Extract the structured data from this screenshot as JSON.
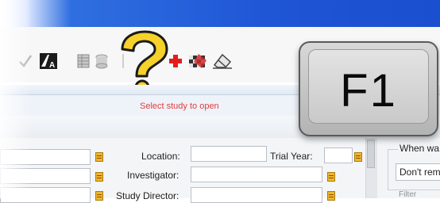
{
  "toolbar": {
    "icons": [
      "check-icon",
      "font-icon",
      "grid-icon",
      "drum-icon",
      "separator-icon",
      "help-icon",
      "plus-icon",
      "flag-icon",
      "eraser-icon"
    ]
  },
  "status": {
    "message": "Select study to open",
    "color": "#e03d3d"
  },
  "form": {
    "location_label": "Location:",
    "trial_year_label": "Trial Year:",
    "investigator_label": "Investigator:",
    "study_director_label": "Study Director:"
  },
  "right_panel": {
    "when_title": "When wa",
    "dont_value": "Don't rem",
    "filter_title": "Filter"
  },
  "overlay": {
    "key_label": "F1"
  },
  "colors": {
    "titlebar": "#1f56d6",
    "lookup_button": "#f2b52e",
    "help_yellow": "#f5d12a"
  }
}
